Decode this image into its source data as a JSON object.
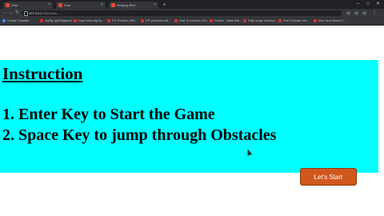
{
  "browser": {
    "tabs": [
      {
        "title": "Dino"
      },
      {
        "title": "Dino"
      },
      {
        "title": "Scrappy Bird"
      }
    ],
    "newtab_label": "+",
    "window_controls": [
      "–",
      "□",
      "✕"
    ],
    "url": "127.0.0.1",
    "url_hint": "Find tools - ..."
  },
  "bookmarks": [
    "Google Translate",
    "dd(Bkp gydEBgamos...",
    "Hope index-tdy/1y...",
    "DIY Practice | Bhil...",
    "DIY practical-nodl...",
    "How To succeed a Bl...",
    "Finders - Make Mat...",
    "Daily usage common...",
    "Free Firebase resr...",
    "Intro Here Secure C..."
  ],
  "instructions": {
    "heading": "Instruction",
    "line1": "1. Enter Key to Start the Game",
    "line2": "2. Space Key to jump through Obstacles"
  },
  "start_button": {
    "label": "Let's Start"
  },
  "colors": {
    "panel_bg": "#00ffff",
    "button_bg": "#d0581c"
  }
}
